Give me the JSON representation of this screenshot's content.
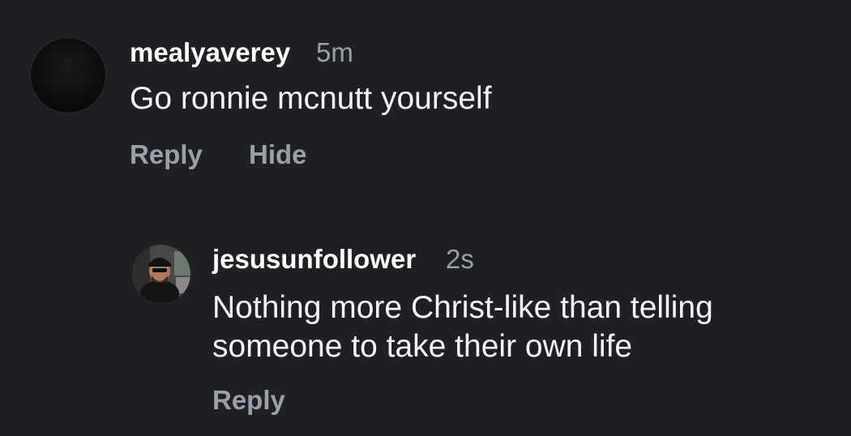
{
  "comments": [
    {
      "username": "mealyaverey",
      "time": "5m",
      "text": "Go ronnie mcnutt yourself",
      "actions": {
        "reply": "Reply",
        "hide": "Hide"
      }
    },
    {
      "username": "jesusunfollower",
      "time": "2s",
      "text_line1": "Nothing more Christ-like than telling",
      "text_line2": "someone to take their own life",
      "actions": {
        "reply": "Reply"
      }
    }
  ]
}
